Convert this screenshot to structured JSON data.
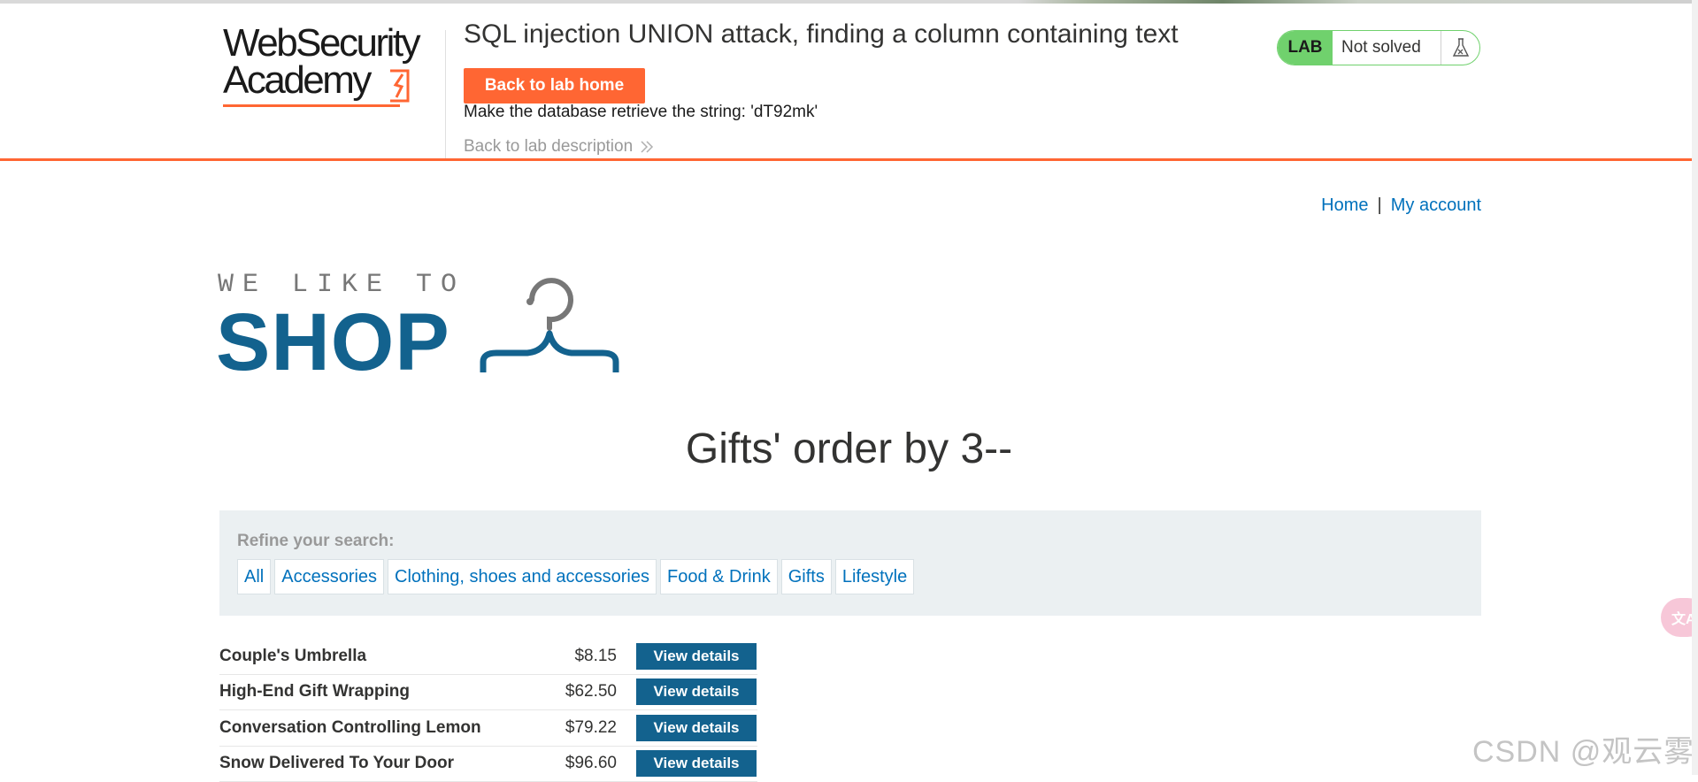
{
  "academy": {
    "logo_line1": "WebSecurity",
    "logo_line2": "Academy",
    "lab_title": "SQL injection UNION attack, finding a column containing text",
    "back_home": "Back to lab home",
    "description": "Make the database retrieve the string: 'dT92mk'",
    "back_description": "Back to lab description",
    "status_badge": "LAB",
    "status_text": "Not solved",
    "status_icon": "flask-icon"
  },
  "nav": {
    "home": "Home",
    "separator": "|",
    "my_account": "My account"
  },
  "shop_logo": {
    "tagline": "WE LIKE TO",
    "word": "SHOP"
  },
  "page": {
    "heading": "Gifts' order by 3--"
  },
  "filters": {
    "label": "Refine your search:",
    "items": [
      "All",
      "Accessories",
      "Clothing, shoes and accessories",
      "Food & Drink",
      "Gifts",
      "Lifestyle"
    ]
  },
  "products": [
    {
      "name": "Couple's Umbrella",
      "price": "$8.15",
      "action": "View details"
    },
    {
      "name": "High-End Gift Wrapping",
      "price": "$62.50",
      "action": "View details"
    },
    {
      "name": "Conversation Controlling Lemon",
      "price": "$79.22",
      "action": "View details"
    },
    {
      "name": "Snow Delivered To Your Door",
      "price": "$96.60",
      "action": "View details"
    }
  ],
  "overlay": {
    "translate_glyph": "文A",
    "watermark": "CSDN @观云雾"
  },
  "colors": {
    "accent_orange": "#ff6633",
    "brand_blue": "#13628e",
    "link_blue": "#0071bc",
    "status_green": "#70d16d",
    "filter_bg": "#ebf0f2"
  }
}
